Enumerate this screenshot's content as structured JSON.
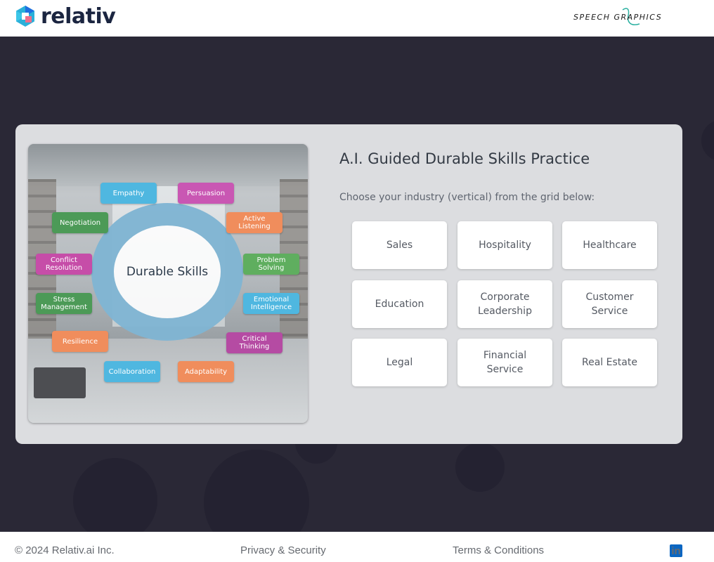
{
  "header": {
    "brand": "relativ",
    "partner_logo": "SPEECH GRAPHICS"
  },
  "colors": {
    "background": "#2a2836",
    "card": "#dcdde0",
    "brand_navy": "#1b2540",
    "brand_cyan": "#2bb0d9",
    "brand_blue": "#1f6fe0",
    "brand_pink": "#f06e8a"
  },
  "hero": {
    "center_label": "Durable Skills",
    "skills": [
      {
        "label": "Empathy",
        "color": "#4fb7e0"
      },
      {
        "label": "Persuasion",
        "color": "#c957b3"
      },
      {
        "label": "Negotiation",
        "color": "#4c9a57"
      },
      {
        "label": "Active Listening",
        "color": "#f08d5c"
      },
      {
        "label": "Conflict Resolution",
        "color": "#c64da8"
      },
      {
        "label": "Problem Solving",
        "color": "#5fae5f"
      },
      {
        "label": "Stress Management",
        "color": "#4c9a57"
      },
      {
        "label": "Emotional Intelligence",
        "color": "#4fb7e0"
      },
      {
        "label": "Resilience",
        "color": "#f08d5c"
      },
      {
        "label": "Critical Thinking",
        "color": "#b54ba3"
      },
      {
        "label": "Collaboration",
        "color": "#4fb7e0"
      },
      {
        "label": "Adaptability",
        "color": "#f08d5c"
      }
    ]
  },
  "main": {
    "title": "A.I. Guided Durable Skills Practice",
    "subtitle": "Choose your industry (vertical) from the grid below:",
    "industries": [
      "Sales",
      "Hospitality",
      "Healthcare",
      "Education",
      "Corporate Leadership",
      "Customer Service",
      "Legal",
      "Financial Service",
      "Real Estate"
    ]
  },
  "footer": {
    "copyright": "© 2024 Relativ.ai Inc.",
    "privacy": "Privacy & Security",
    "terms": "Terms & Conditions",
    "social_icon": "linkedin-icon",
    "social_glyph": "in"
  }
}
